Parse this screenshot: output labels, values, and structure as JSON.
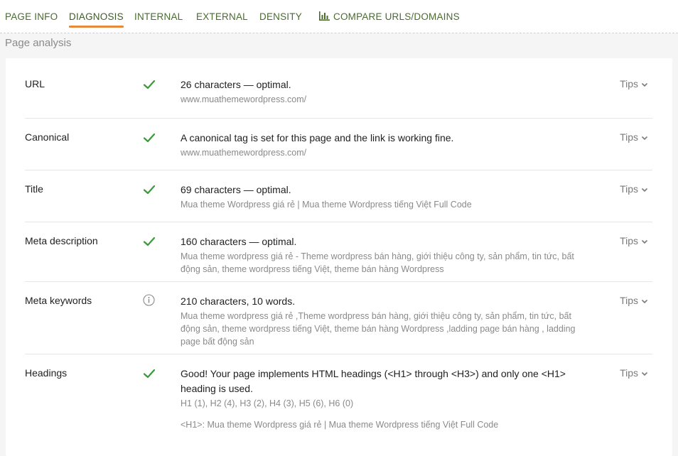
{
  "tabs": [
    {
      "label": "PAGE INFO"
    },
    {
      "label": "DIAGNOSIS"
    },
    {
      "label": "INTERNAL"
    },
    {
      "label": "EXTERNAL"
    },
    {
      "label": "DENSITY"
    },
    {
      "label": "COMPARE URLS/DOMAINS",
      "icon": "bar-chart-icon"
    }
  ],
  "active_tab": "DIAGNOSIS",
  "section_title": "Page analysis",
  "colors": {
    "accent": "#e8883a",
    "tab_text": "#4a6b2f",
    "check": "#3a9a3a"
  },
  "rows": [
    {
      "label": "URL",
      "status": "ok",
      "summary": "26 characters — optimal.",
      "detail": "www.muathemewordpress.com/",
      "tips": "Tips"
    },
    {
      "label": "Canonical",
      "status": "ok",
      "summary": "A canonical tag is set for this page and the link is working fine.",
      "detail": "www.muathemewordpress.com/",
      "tips": "Tips"
    },
    {
      "label": "Title",
      "status": "ok",
      "summary": "69 characters — optimal.",
      "detail": "Mua theme Wordpress giá rẻ | Mua theme Wordpress tiếng Việt Full Code",
      "tips": "Tips"
    },
    {
      "label": "Meta description",
      "status": "ok",
      "summary": "160 characters — optimal.",
      "detail": "Mua theme wordpress giá rẻ - Theme wordpress bán hàng, giới thiệu công ty, sản phẩm, tin tức, bất động sản, theme wordpress tiếng Việt, theme bán hàng Wordpress",
      "tips": "Tips"
    },
    {
      "label": "Meta keywords",
      "status": "info",
      "summary": "210 characters, 10 words.",
      "detail": "Mua theme wordpress giá rẻ ,Theme wordpress bán hàng, giới thiệu công ty, sản phẩm, tin tức, bất động sản, theme wordpress tiếng Việt, theme bán hàng Wordpress ,ladding page bán hàng , ladding page bất động sản",
      "tips": "Tips"
    },
    {
      "label": "Headings",
      "status": "ok",
      "summary": "Good! Your page implements HTML headings (<H1> through <H3>) and only one <H1> heading is used.",
      "detail": "H1 (1), H2 (4), H3 (2), H4 (3), H5 (6), H6 (0)",
      "detail2": "<H1>: Mua theme Wordpress giá rẻ | Mua theme Wordpress tiếng Việt Full Code",
      "tips": "Tips"
    }
  ]
}
